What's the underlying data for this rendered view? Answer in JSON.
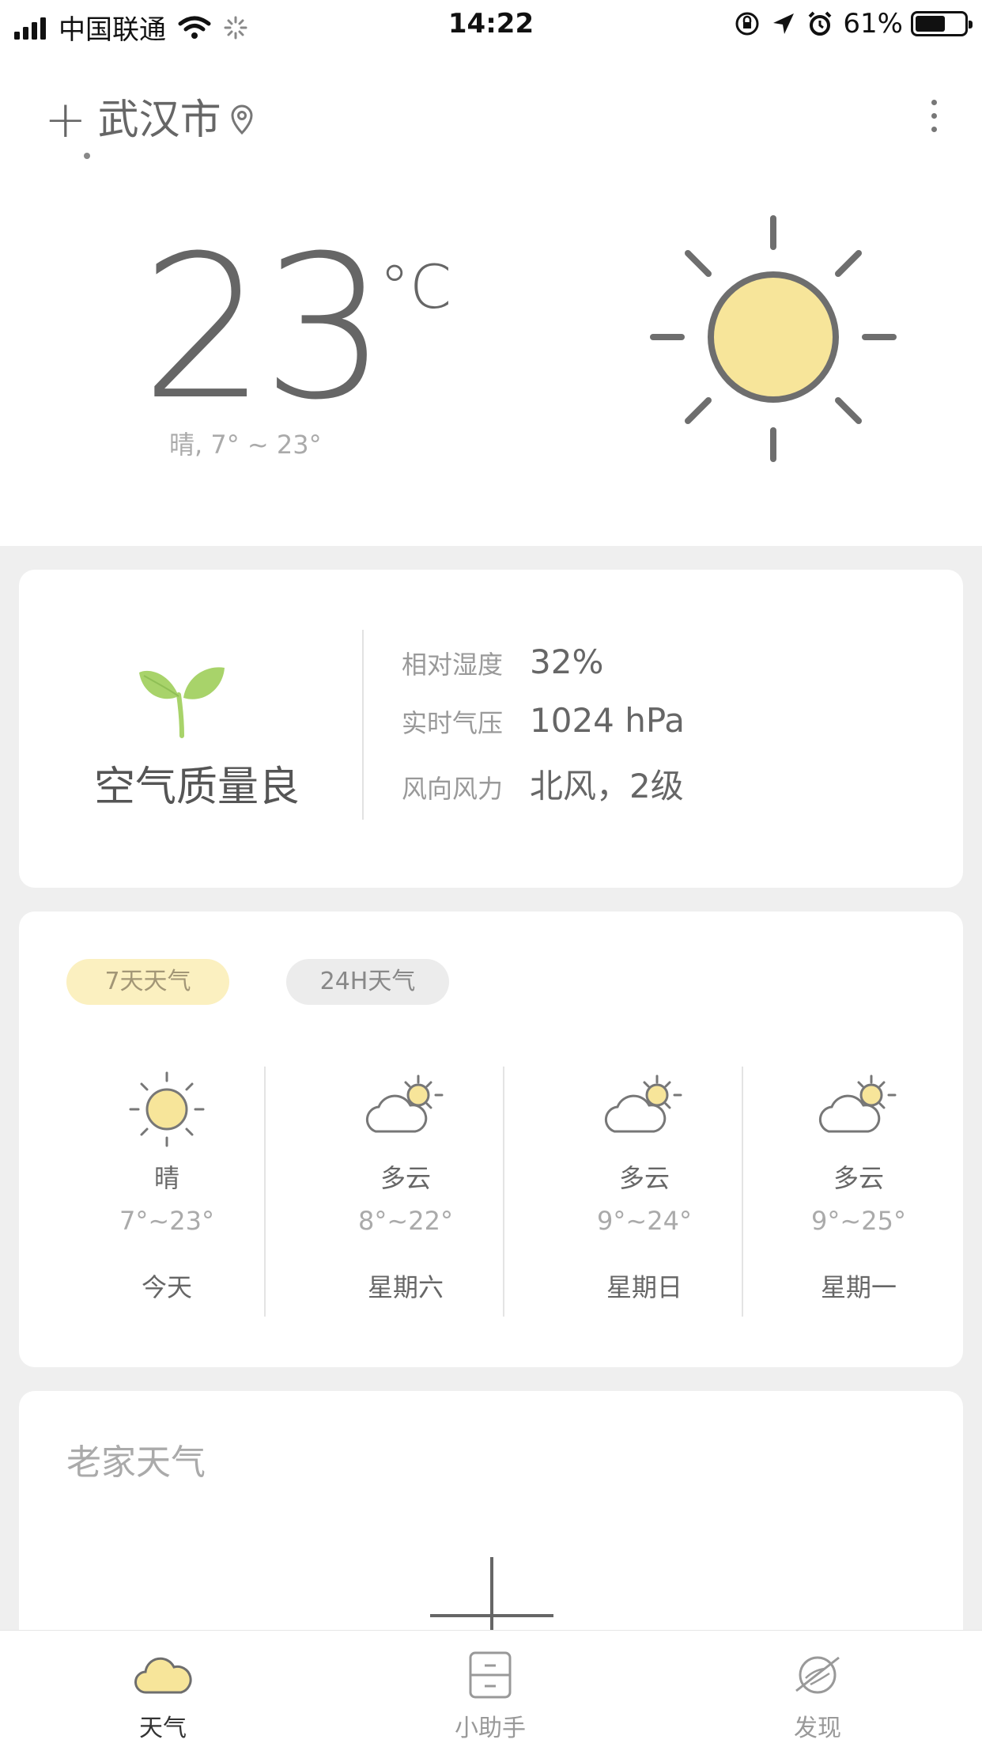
{
  "status_bar": {
    "carrier": "中国联通",
    "time": "14:22",
    "battery": "61%",
    "battery_level": 0.61
  },
  "header": {
    "add_symbol": "+",
    "city": "武汉市"
  },
  "current": {
    "temperature": "23",
    "unit": "°C",
    "summary": "晴, 7° ~ 23°"
  },
  "air_card": {
    "air_quality": "空气质量良",
    "rows": [
      {
        "label": "相对湿度",
        "value": "32%"
      },
      {
        "label": "实时气压",
        "value": "1024 hPa"
      },
      {
        "label": "风向风力",
        "value": "北风，2级"
      }
    ]
  },
  "forecast": {
    "tabs": [
      "7天天气",
      "24H天气"
    ],
    "active_tab": "7天天气",
    "days": [
      {
        "icon": "sun-icon",
        "condition": "晴",
        "range": "7°~23°",
        "day": "今天"
      },
      {
        "icon": "partly-cloudy-icon",
        "condition": "多云",
        "range": "8°~22°",
        "day": "星期六"
      },
      {
        "icon": "partly-cloudy-icon",
        "condition": "多云",
        "range": "9°~24°",
        "day": "星期日"
      },
      {
        "icon": "partly-cloudy-icon",
        "condition": "多云",
        "range": "9°~25°",
        "day": "星期一"
      }
    ]
  },
  "home_card": {
    "title": "老家天气"
  },
  "bottom_nav": {
    "items": [
      {
        "label": "天气",
        "icon": "cloud-icon"
      },
      {
        "label": "小助手",
        "icon": "cabinet-icon"
      },
      {
        "label": "发现",
        "icon": "planet-icon"
      }
    ]
  },
  "colors": {
    "sun_fill": "#f7e59a",
    "accent_tab": "#fbf0c0",
    "leaf_green": "#a8d36a"
  }
}
